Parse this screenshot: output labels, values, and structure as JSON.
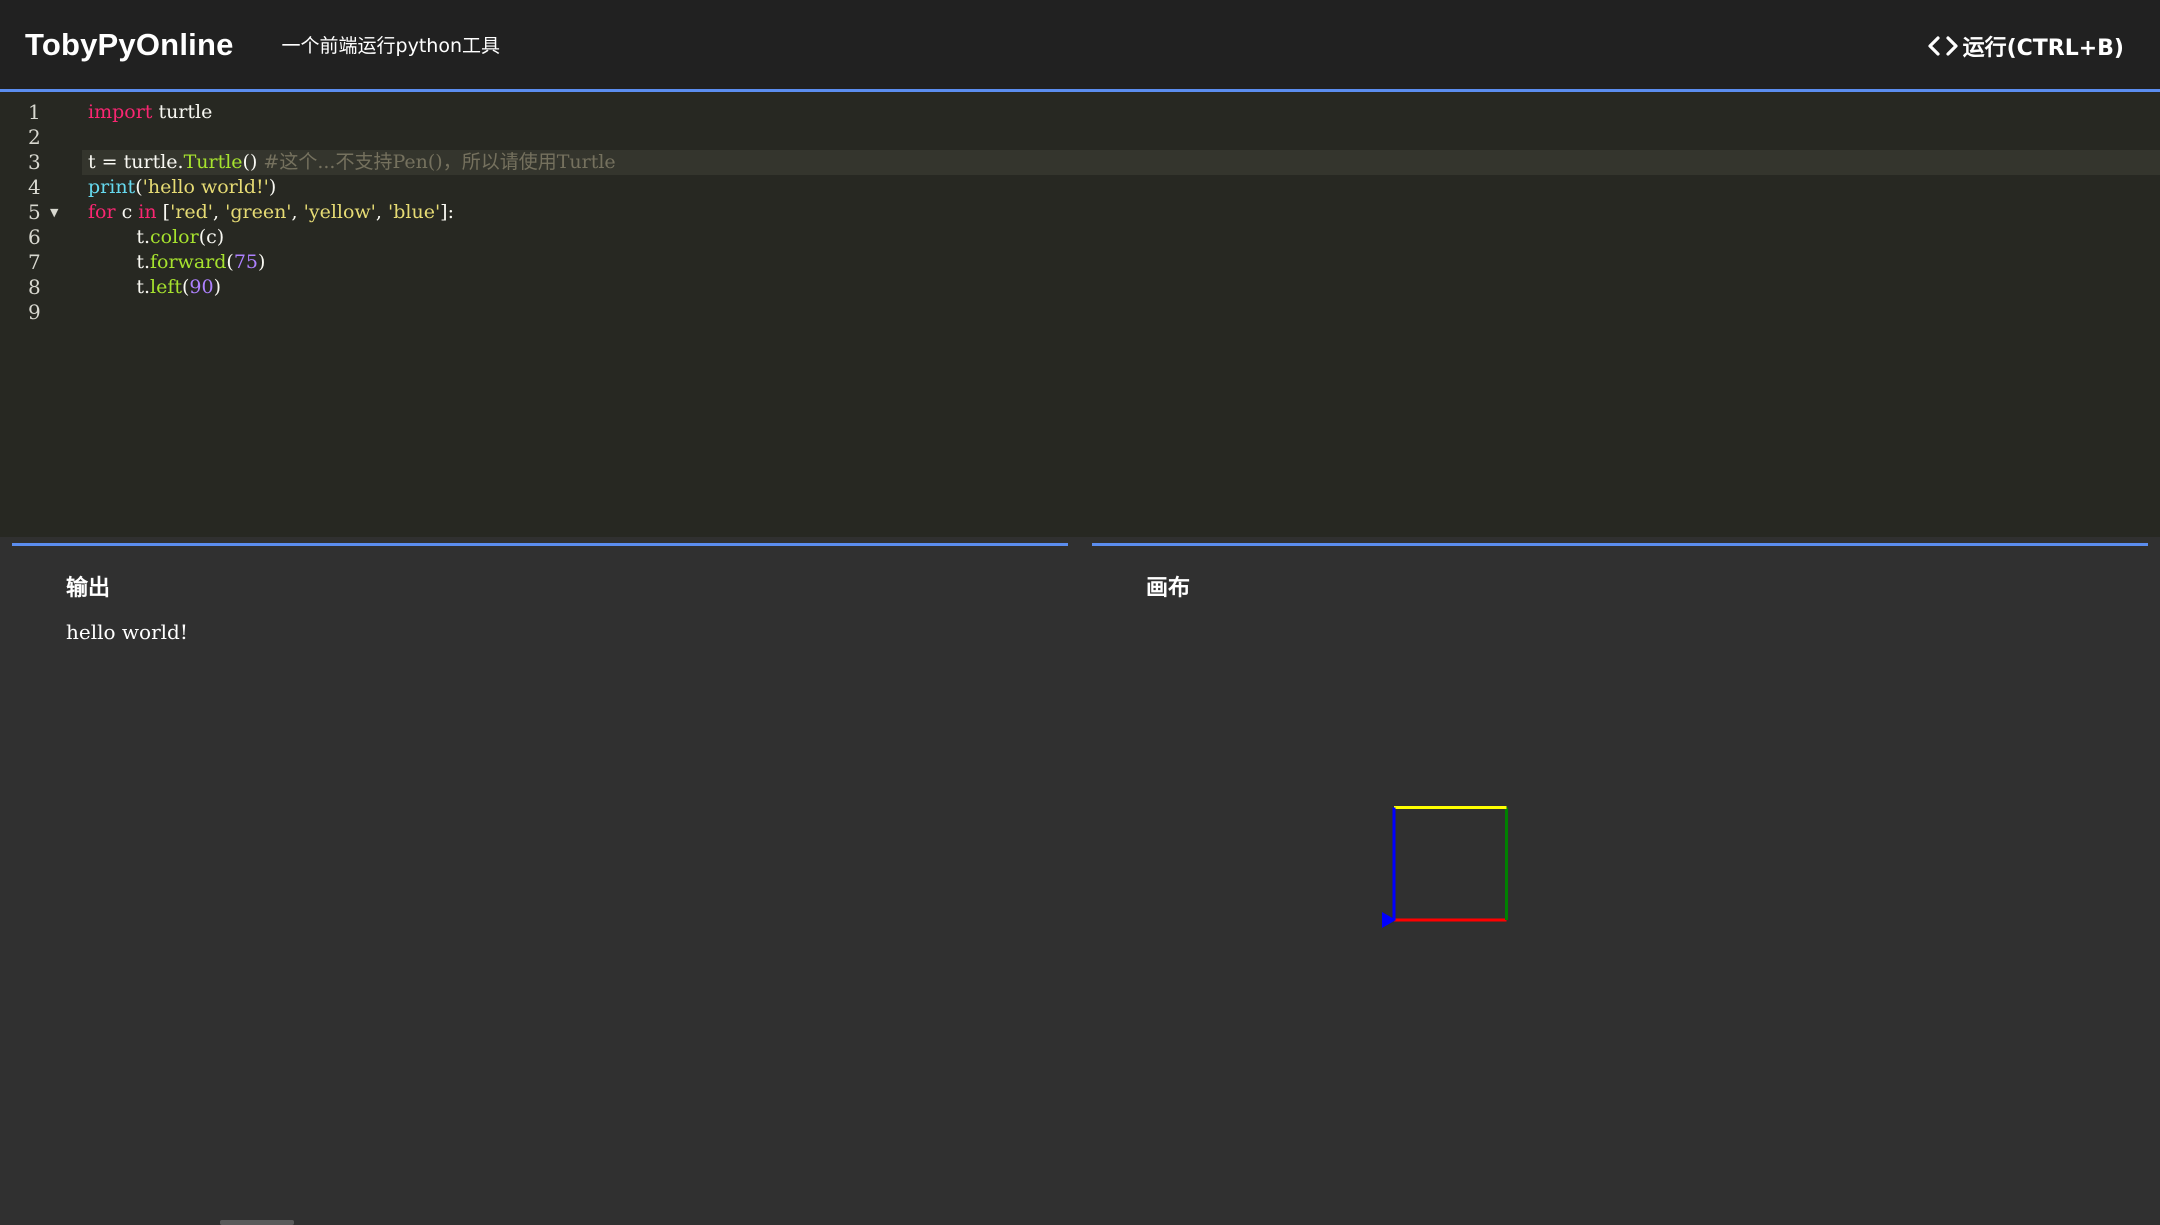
{
  "header": {
    "brand": "TobyPyOnline",
    "subtitle": "一个前端运行python工具",
    "run_label": "运行(CTRL+B)"
  },
  "editor": {
    "line_numbers": [
      "1",
      "2",
      "3",
      "4",
      "5",
      "6",
      "7",
      "8",
      "9"
    ],
    "fold_marker_line": 5,
    "active_line": 3,
    "code": [
      "import turtle",
      "",
      "t = turtle.Turtle() #这个...不支持Pen()，所以请使用Turtle",
      "print('hello world!')",
      "for c in ['red', 'green', 'yellow', 'blue']:",
      "        t.color(c)",
      "        t.forward(75)",
      "        t.left(90)",
      ""
    ]
  },
  "output_panel": {
    "title": "输出",
    "text": "hello world!"
  },
  "canvas_panel": {
    "title": "画布",
    "square_side": 75,
    "segments": [
      {
        "color": "#ff0000",
        "heading": 0
      },
      {
        "color": "#008000",
        "heading": 90
      },
      {
        "color": "#ffff00",
        "heading": 180
      },
      {
        "color": "#0000ff",
        "heading": 270
      }
    ],
    "turtle_color": "#0000ff"
  },
  "colors": {
    "accent": "#5b8def",
    "topbar_bg": "#212121",
    "editor_bg": "#272822",
    "panel_bg": "#303030"
  }
}
